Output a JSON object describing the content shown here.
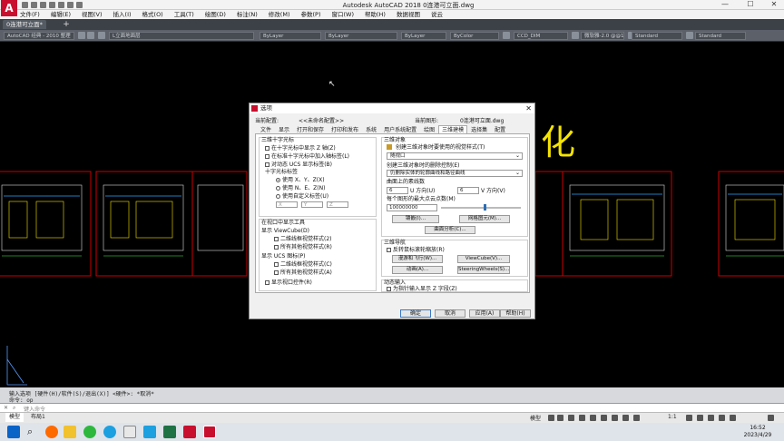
{
  "app": {
    "title": "Autodesk AutoCAD 2018    0连港可立面.dwg",
    "logo_letter": "A",
    "window_controls": [
      "—",
      "☐",
      "✕"
    ]
  },
  "menu": [
    "文件(F)",
    "编辑(E)",
    "视图(V)",
    "插入(I)",
    "格式(O)",
    "工具(T)",
    "绘图(D)",
    "标注(N)",
    "修改(M)",
    "参数(P)",
    "窗口(W)",
    "帮助(H)",
    "数据视图",
    "说云"
  ],
  "doc_tabs": {
    "active": "0连港可立面*",
    "add": "+"
  },
  "toolbar": {
    "workspace": "AutoCAD 经典 - 2010 整理",
    "layer": "L立面地面层",
    "color": "ByLayer",
    "linetype": "ByLayer",
    "lineweight": "ByLayer",
    "plotstyle": "ByColor",
    "dimstyle": "CCD_DIM",
    "textstyle": "微软雅-2.0 @@1",
    "tablestyle": "Standard",
    "mleaderstyle": "Standard"
  },
  "canvas": {
    "big_text": "化",
    "crosshair_icon": "ucs-icon"
  },
  "command": {
    "lines": [
      "输入选项 [硬件(H)/软件(S)/退出(X)] <硬件>: *取消*",
      "命令: op"
    ],
    "placeholder": "键入命令"
  },
  "status": {
    "layout_tabs": [
      "模型",
      "布局1"
    ],
    "model_label": "模型",
    "scale": "1:1"
  },
  "taskbar": {
    "time": "16:52",
    "date": "2023/4/29"
  },
  "dialog": {
    "title": "选项",
    "current_profile_label": "当前配置:",
    "current_profile_value": "<<未命名配置>>",
    "current_drawing_label": "当前图形:",
    "current_drawing_value": "0连港可立面.dwg",
    "tabs": [
      "文件",
      "显示",
      "打开和保存",
      "打印和发布",
      "系统",
      "用户系统配置",
      "绘图",
      "三维建模",
      "选择集",
      "配置"
    ],
    "active_tab": "三维建模",
    "crosshair": {
      "title": "三维十字光标",
      "options": [
        {
          "label": "在十字光标中显示 Z 轴(Z)",
          "checked": false
        },
        {
          "label": "在标准十字光标中加入轴标签(L)",
          "checked": false
        },
        {
          "label": "对动态 UCS 显示标签(B)",
          "checked": false
        }
      ],
      "labels_title": "十字光标标签",
      "radios": [
        {
          "label": "使用 X、Y、Z(X)",
          "checked": true
        },
        {
          "label": "使用 N、E、Z(N)",
          "checked": false
        },
        {
          "label": "使用自定义标签(U)",
          "checked": false
        }
      ],
      "custom_fields": [
        "X",
        "Y",
        "Z"
      ]
    },
    "viewport_tools": {
      "title": "在视口中显示工具",
      "viewcube_label": "显示 ViewCube(D)",
      "viewcube_opts": [
        "二维线框视觉样式(2)",
        "所有其他视觉样式(R)"
      ],
      "ucs_label": "显示 UCS 图标(P)",
      "ucs_opts": [
        "二维线框视觉样式(C)",
        "所有其他视觉样式(A)"
      ],
      "viewport_controls": "显示视口控件(R)"
    },
    "objects3d": {
      "title": "三维对象",
      "visual_style_label": "创建三维对象时要使用的视觉样式(T)",
      "visual_style_value": "随视口",
      "deletion_label": "创建三维对象时的删除控制(E)",
      "deletion_value": "仍删除实体的轮廓曲线和路径曲线",
      "isolines_label": "曲面上的素线数",
      "u_value": "6",
      "u_label": "U 方向(U)",
      "v_value": "6",
      "v_label": "V 方向(V)",
      "max_points_label": "每个图形的最大点云点数(M)",
      "max_points_value": "100000000",
      "max_points_level": 0.55,
      "tessellation_btn": "镶嵌(I)...",
      "mesh_primitives_btn": "网格图元(M)...",
      "surface_analysis_btn": "曲面分析(C)..."
    },
    "nav3d": {
      "title": "三维导航",
      "reverse_wheel": "反转鼠标滚轮缩放(R)",
      "walkfly_btn": "漫游和飞行(W)...",
      "viewcube_btn": "ViewCube(V)...",
      "animation_btn": "动画(A)...",
      "steering_btn": "SteeringWheels(S)..."
    },
    "dynamic_input": {
      "title": "动态输入",
      "label": "为指针输入显示 Z 字段(Z)"
    },
    "buttons": {
      "ok": "确定",
      "cancel": "取消",
      "apply": "应用(A)",
      "help": "帮助(H)"
    }
  }
}
